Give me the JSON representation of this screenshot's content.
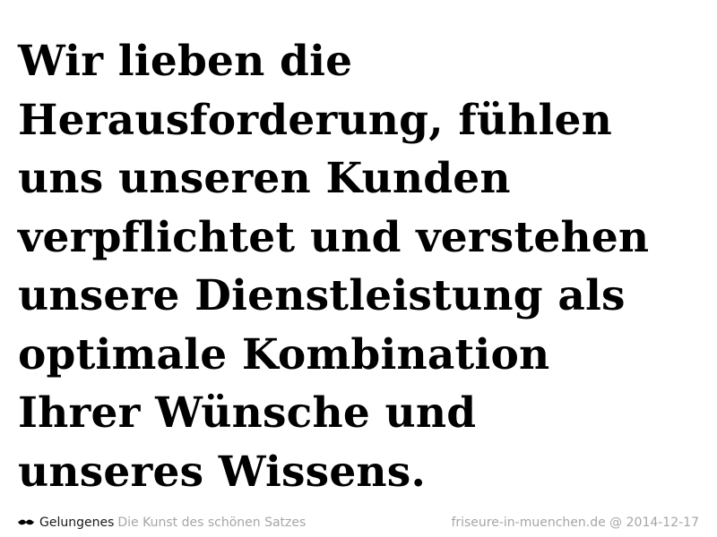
{
  "quote": {
    "lines": [
      "Wir lieben die",
      "Herausforderung, fühlen",
      "uns unseren Kunden",
      "verpflichtet und verstehen",
      "unsere Dienstleistung als",
      "optimale Kombination",
      "Ihrer Wünsche und",
      "unseres Wissens."
    ]
  },
  "footer": {
    "brand_icon": "mustache-icon",
    "brand_name": "Gelungenes",
    "tagline": "Die Kunst des schönen Satzes",
    "source": "friseure-in-muenchen.de @ 2014-12-17"
  },
  "colors": {
    "text": "#000000",
    "muted": "#a6a6a6",
    "background": "#ffffff"
  }
}
